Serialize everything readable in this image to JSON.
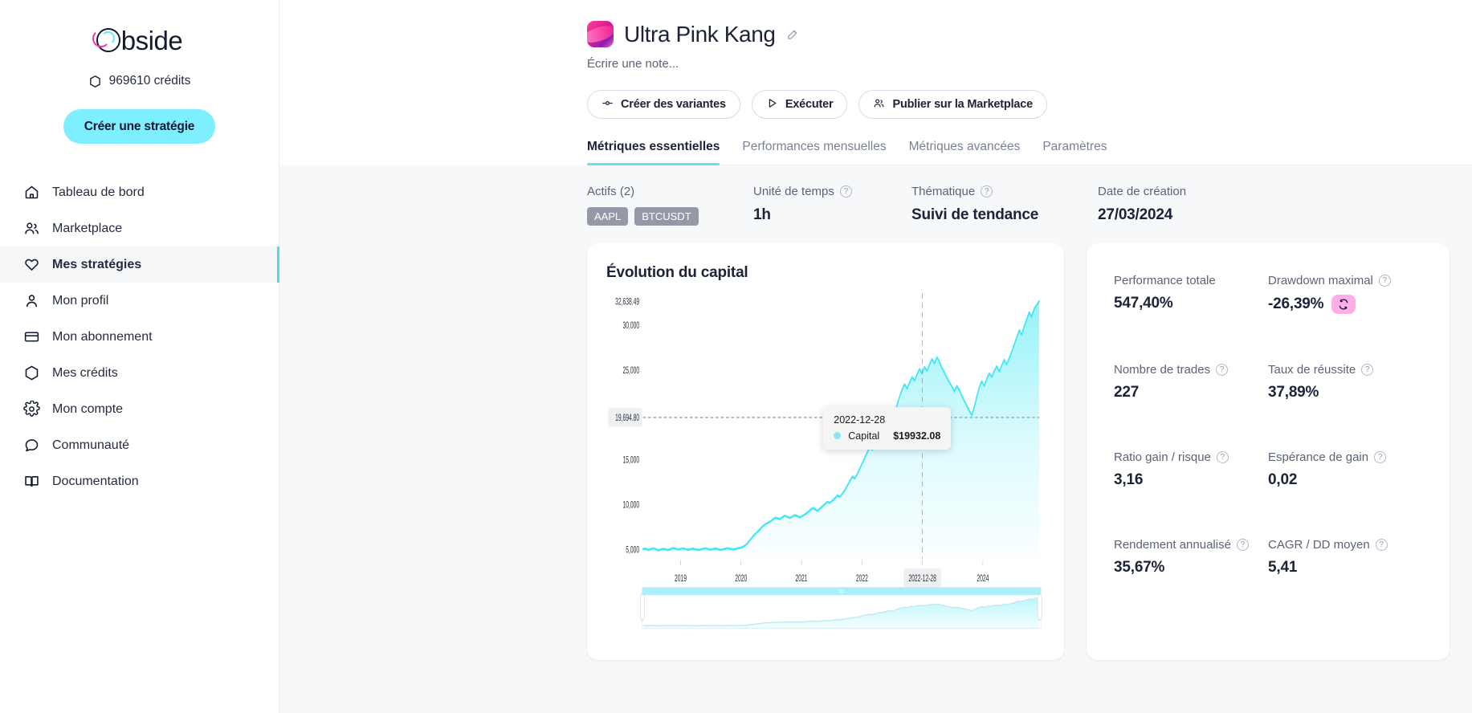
{
  "sidebar": {
    "logo_text": "bside",
    "credits": "969610 crédits",
    "credits_icon": "hexagon-icon",
    "cta_label": "Créer une stratégie",
    "items": [
      {
        "label": "Tableau de bord",
        "icon": "home-icon",
        "active": false
      },
      {
        "label": "Marketplace",
        "icon": "users-icon",
        "active": false
      },
      {
        "label": "Mes stratégies",
        "icon": "heart-icon",
        "active": true
      },
      {
        "label": "Mon profil",
        "icon": "user-icon",
        "active": false
      },
      {
        "label": "Mon abonnement",
        "icon": "credit-card-icon",
        "active": false
      },
      {
        "label": "Mes crédits",
        "icon": "hexagon-icon",
        "active": false
      },
      {
        "label": "Mon compte",
        "icon": "gear-icon",
        "active": false
      },
      {
        "label": "Communauté",
        "icon": "chat-bubble-icon",
        "active": false
      },
      {
        "label": "Documentation",
        "icon": "book-icon",
        "active": false
      }
    ]
  },
  "header": {
    "strategy_title": "Ultra Pink Kang",
    "edit_icon": "edit-pencil-icon",
    "note_placeholder": "Écrire une note...",
    "buttons": [
      {
        "label": "Créer des variantes",
        "icon": "variants-icon"
      },
      {
        "label": "Exécuter",
        "icon": "play-icon"
      },
      {
        "label": "Publier sur la Marketplace",
        "icon": "users-icon"
      }
    ],
    "tabs": [
      {
        "label": "Métriques essentielles",
        "active": true
      },
      {
        "label": "Performances mensuelles",
        "active": false
      },
      {
        "label": "Métriques avancées",
        "active": false
      },
      {
        "label": "Paramètres",
        "active": false
      }
    ]
  },
  "infobar": {
    "assets_label": "Actifs (2)",
    "assets": [
      "AAPL",
      "BTCUSDT"
    ],
    "timeframe_label": "Unité de temps",
    "timeframe_value": "1h",
    "thematic_label": "Thématique",
    "thematic_value": "Suivi de tendance",
    "created_label": "Date de création",
    "created_value": "27/03/2024"
  },
  "chart_panel": {
    "title": "Évolution du capital",
    "tooltip": {
      "date": "2022-12-28",
      "series_label": "Capital",
      "value": "$19932.08"
    }
  },
  "metrics": {
    "items": [
      {
        "label": "Performance totale",
        "value": "547,40%",
        "help": false
      },
      {
        "label": "Drawdown maximal",
        "value": "-26,39%",
        "help": true,
        "badge": "refresh-icon"
      },
      {
        "label": "Nombre de trades",
        "value": "227",
        "help": true
      },
      {
        "label": "Taux de réussite",
        "value": "37,89%",
        "help": true
      },
      {
        "label": "Ratio gain / risque",
        "value": "3,16",
        "help": true
      },
      {
        "label": "Espérance de gain",
        "value": "0,02",
        "help": true
      },
      {
        "label": "Rendement annualisé",
        "value": "35,67%",
        "help": true
      },
      {
        "label": "CAGR / DD moyen",
        "value": "5,41",
        "help": true
      }
    ]
  },
  "colors": {
    "accent_cyan": "#7defff",
    "line_cyan": "#3fe8f5",
    "pink": "#ff2ea6",
    "badge_pink": "#ffaee8",
    "text_dark": "#1c2238",
    "text_muted": "#5c6378"
  },
  "chart_data": {
    "type": "area",
    "title": "Évolution du capital",
    "xlabel": "",
    "ylabel": "",
    "ylim": [
      4000,
      33500
    ],
    "ytick_labels": [
      "32,638.49",
      "30,000",
      "25,000",
      "19,694.80",
      "15,000",
      "10,000",
      "5,000"
    ],
    "ytick_values": [
      32638.49,
      30000,
      25000,
      19694.8,
      15000,
      10000,
      5000
    ],
    "xtick_labels": [
      "2019",
      "2020",
      "2021",
      "2022",
      "2022-12-28",
      "2024"
    ],
    "highlighted_xtick": "2022-12-28",
    "highlighted_ytick": "19,694.80",
    "grid": false,
    "legend": [
      "Capital"
    ],
    "series": [
      {
        "name": "Capital",
        "color": "#3fe8f5",
        "values": [
          5050,
          5080,
          4950,
          5010,
          5120,
          5040,
          4900,
          4980,
          5060,
          5000,
          4930,
          5020,
          5150,
          5080,
          4990,
          5040,
          5110,
          5030,
          4960,
          5020,
          5090,
          5010,
          4940,
          4990,
          5060,
          5130,
          5040,
          4970,
          5030,
          5100,
          5020,
          4950,
          5000,
          5070,
          5140,
          5060,
          4990,
          5040,
          5110,
          5180,
          5260,
          5450,
          5700,
          6050,
          6420,
          6700,
          6980,
          7250,
          7560,
          7800,
          7950,
          8100,
          8300,
          8520,
          8450,
          8380,
          8600,
          8750,
          8620,
          8500,
          8680,
          8820,
          8700,
          8560,
          8740,
          8900,
          9100,
          9350,
          9600,
          9480,
          9300,
          9550,
          9800,
          10050,
          10300,
          10180,
          10420,
          10700,
          11000,
          10850,
          11200,
          11600,
          12100,
          12600,
          13100,
          12900,
          13400,
          14000,
          14600,
          15200,
          15800,
          16400,
          16100,
          16800,
          17500,
          18200,
          17900,
          18600,
          19300,
          19932,
          19500,
          20300,
          21100,
          22000,
          22800,
          23400,
          22900,
          23600,
          24200,
          23800,
          24500,
          25100,
          24600,
          25300,
          24900,
          25600,
          26200,
          25700,
          26400,
          25900,
          25200,
          24700,
          24100,
          23600,
          23100,
          22600,
          23200,
          22700,
          22100,
          21500,
          21000,
          20400,
          19932,
          20900,
          22000,
          23100,
          23700,
          23200,
          24000,
          24600,
          24200,
          24900,
          25400,
          24800,
          25500,
          26100,
          25600,
          26300,
          27000,
          27800,
          28600,
          29400,
          28900,
          29800,
          30600,
          31400,
          30900,
          31800,
          32200,
          32638
        ]
      }
    ]
  }
}
